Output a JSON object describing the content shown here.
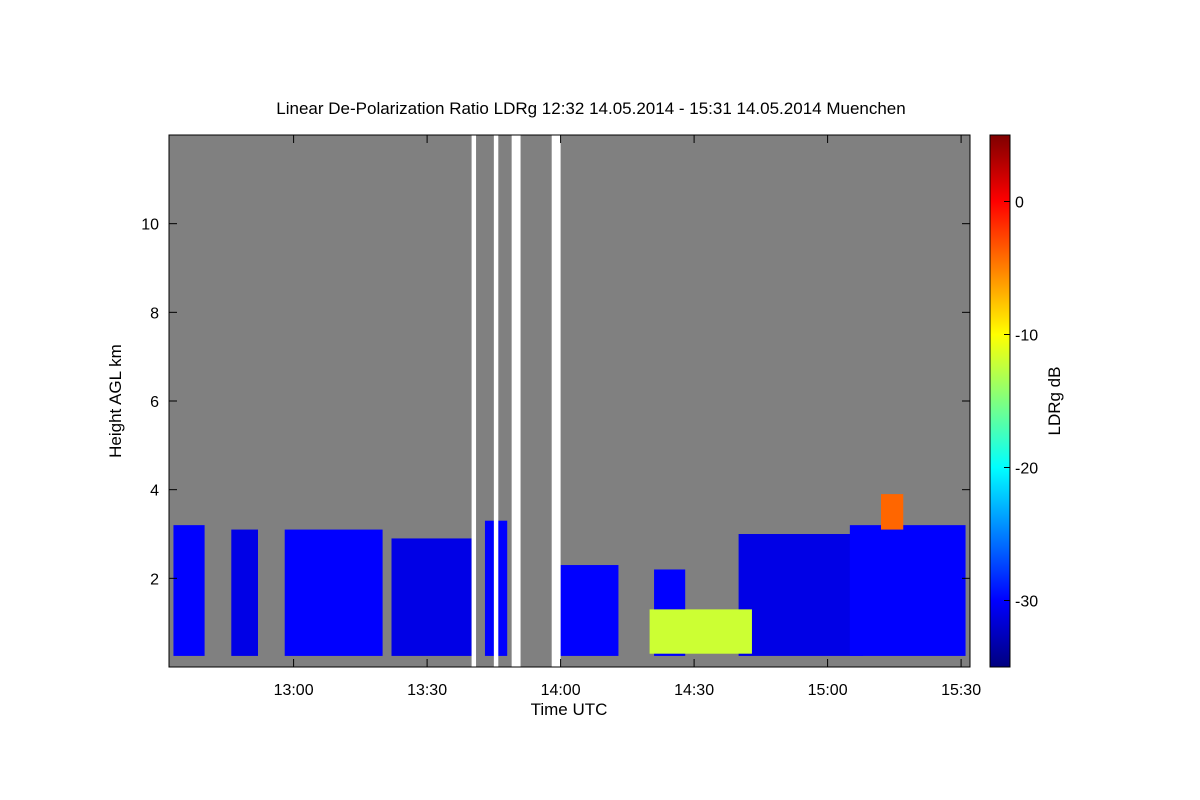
{
  "chart_data": {
    "type": "heatmap",
    "title": "Linear De-Polarization Ratio LDRg   12:32 14.05.2014 - 15:31 14.05.2014 Muenchen",
    "xlabel": "Time UTC",
    "ylabel": "Height AGL km",
    "colorbar_label": "LDRg dB",
    "x_range": [
      "12:32",
      "15:31"
    ],
    "xlim_minutes": [
      752,
      932
    ],
    "ylim": [
      0,
      12
    ],
    "x_ticks": [
      {
        "label": "13:00",
        "minutes": 780
      },
      {
        "label": "13:30",
        "minutes": 810
      },
      {
        "label": "14:00",
        "minutes": 840
      },
      {
        "label": "14:30",
        "minutes": 870
      },
      {
        "label": "15:00",
        "minutes": 900
      },
      {
        "label": "15:30",
        "minutes": 930
      }
    ],
    "y_ticks": [
      2,
      4,
      6,
      8,
      10
    ],
    "colorbar_range": [
      -35,
      5
    ],
    "colorbar_ticks": [
      0,
      -10,
      -20,
      -30
    ],
    "no_signal_color": "#808080",
    "missing_color": "#ffffff",
    "colormap": "jet",
    "features": [
      {
        "kind": "cloud",
        "start": "12:33",
        "end": "12:40",
        "top_km": 3.2,
        "ldr_db": -30
      },
      {
        "kind": "cloud",
        "start": "12:46",
        "end": "12:52",
        "top_km": 3.1,
        "ldr_db": -31
      },
      {
        "kind": "cloud",
        "start": "12:58",
        "end": "13:20",
        "top_km": 3.1,
        "ldr_db": -30
      },
      {
        "kind": "cloud",
        "start": "13:22",
        "end": "13:40",
        "top_km": 2.9,
        "ldr_db": -31
      },
      {
        "kind": "cloud",
        "start": "13:43",
        "end": "13:48",
        "top_km": 3.3,
        "ldr_db": -30
      },
      {
        "kind": "cloud",
        "start": "14:00",
        "end": "14:13",
        "top_km": 2.3,
        "ldr_db": -30
      },
      {
        "kind": "cloud",
        "start": "14:21",
        "end": "14:28",
        "top_km": 2.2,
        "ldr_db": -30
      },
      {
        "kind": "cloud",
        "start": "14:40",
        "end": "15:08",
        "top_km": 3.0,
        "ldr_db": -31
      },
      {
        "kind": "cloud",
        "start": "15:05",
        "end": "15:31",
        "top_km": 3.2,
        "ldr_db": -30
      },
      {
        "kind": "high-ldr-layer",
        "start": "15:12",
        "end": "15:17",
        "bottom_km": 3.1,
        "top_km": 3.9,
        "ldr_db": -4
      },
      {
        "kind": "aerosol-layer",
        "start": "14:20",
        "end": "14:43",
        "bottom_km": 0.3,
        "top_km": 1.3,
        "ldr_db": -12
      },
      {
        "kind": "missing-data",
        "start": "13:40",
        "end": "13:41"
      },
      {
        "kind": "missing-data",
        "start": "13:45",
        "end": "13:46"
      },
      {
        "kind": "missing-data",
        "start": "13:49",
        "end": "13:51"
      },
      {
        "kind": "missing-data",
        "start": "13:58",
        "end": "14:00"
      }
    ]
  },
  "colors": {
    "background": "#808080",
    "missing": "#ffffff"
  }
}
